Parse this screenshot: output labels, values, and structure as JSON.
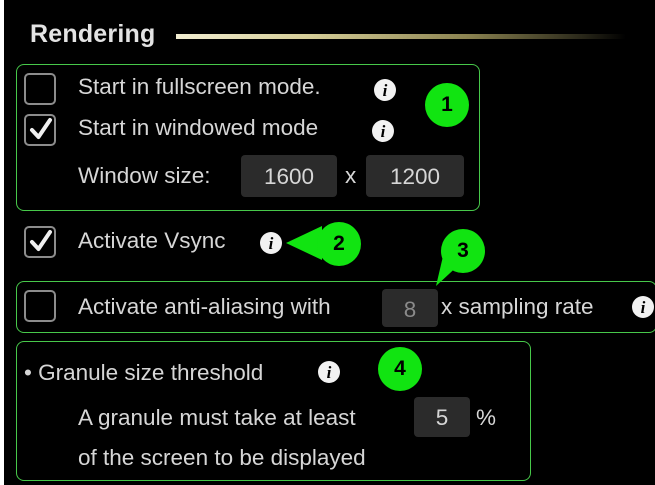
{
  "section": {
    "title": "Rendering"
  },
  "screen_mode": {
    "fullscreen": {
      "label": "Start in fullscreen mode.",
      "checked": false
    },
    "windowed": {
      "label": "Start in windowed mode",
      "checked": true
    },
    "window_size": {
      "label": "Window size:",
      "width": "1600",
      "separator": "x",
      "height": "1200"
    }
  },
  "vsync": {
    "label": "Activate Vsync",
    "checked": true
  },
  "antialiasing": {
    "label": "Activate anti-aliasing with",
    "samples": "8",
    "suffix": "x sampling rate",
    "checked": false
  },
  "granule": {
    "title": "• Granule size threshold",
    "line1": "A granule must take at least",
    "value": "5",
    "unit": "%",
    "line2": "of the screen to be displayed"
  },
  "info_glyph": "i",
  "callouts": [
    "1",
    "2",
    "3",
    "4"
  ],
  "colors": {
    "background": "#000000",
    "group_border": "#47c84a",
    "callout": "#11e411",
    "text": "#d6d6d6",
    "field_bg": "#2b2b2b"
  },
  "icons": [
    "checkbox",
    "checkmark-icon",
    "info-icon",
    "callout-badge"
  ]
}
